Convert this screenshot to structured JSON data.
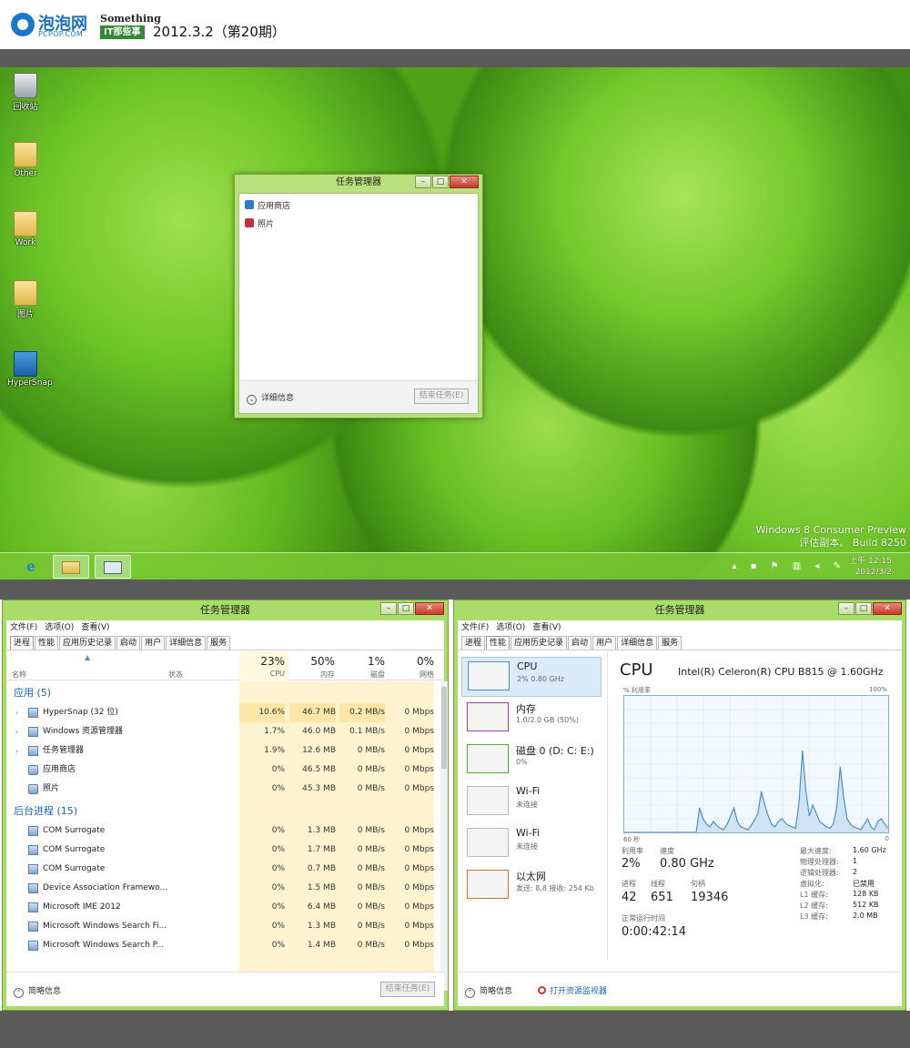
{
  "banner": {
    "logo_cn": "泡泡网",
    "logo_en": "PCPOP.COM",
    "column_en": "Something",
    "column_cn": "IT那些事",
    "issue": "2012.3.2（第20期）"
  },
  "desktop": {
    "icons": [
      {
        "label": "回收站",
        "icon": "recycle-bin-icon"
      },
      {
        "label": "Other",
        "icon": "folder-icon"
      },
      {
        "label": "Work",
        "icon": "folder-icon"
      },
      {
        "label": "图片",
        "icon": "folder-icon"
      },
      {
        "label": "HyperSnap",
        "icon": "hypersnap-icon"
      }
    ],
    "watermark_line1": "Windows 8 Consumer Preview",
    "watermark_line2": "评估副本。 Build 8250",
    "clock_time": "上午 12:15",
    "clock_date": "2012/3/2"
  },
  "small_tm": {
    "title": "任务管理器",
    "items": [
      "应用商店",
      "照片"
    ],
    "details": "详细信息",
    "end_task": "结束任务(E)"
  },
  "menu": [
    "文件(F)",
    "选项(O)",
    "查看(V)"
  ],
  "tabs": [
    "进程",
    "性能",
    "应用历史记录",
    "启动",
    "用户",
    "详细信息",
    "服务"
  ],
  "processes": {
    "title": "任务管理器",
    "col_name": "名称",
    "col_status": "状态",
    "cpu_pct": "23%",
    "cpu_lbl": "CPU",
    "mem_pct": "50%",
    "mem_lbl": "内存",
    "disk_pct": "1%",
    "disk_lbl": "磁盘",
    "net_pct": "0%",
    "net_lbl": "网络",
    "group_apps": "应用 (5)",
    "group_bg": "后台进程 (15)",
    "apps": [
      {
        "name": "HyperSnap (32 位)",
        "cpu": "10.6%",
        "mem": "46.7 MB",
        "disk": "0.2 MB/s",
        "net": "0 Mbps",
        "expand": "›"
      },
      {
        "name": "Windows 资源管理器",
        "cpu": "1.7%",
        "mem": "46.0 MB",
        "disk": "0.1 MB/s",
        "net": "0 Mbps",
        "expand": "›"
      },
      {
        "name": "任务管理器",
        "cpu": "1.9%",
        "mem": "12.6 MB",
        "disk": "0 MB/s",
        "net": "0 Mbps",
        "expand": "›"
      },
      {
        "name": "应用商店",
        "cpu": "0%",
        "mem": "46.5 MB",
        "disk": "0 MB/s",
        "net": "0 Mbps",
        "expand": ""
      },
      {
        "name": "照片",
        "cpu": "0%",
        "mem": "45.3 MB",
        "disk": "0 MB/s",
        "net": "0 Mbps",
        "expand": ""
      }
    ],
    "background": [
      {
        "name": "COM Surrogate",
        "cpu": "0%",
        "mem": "1.3 MB",
        "disk": "0 MB/s",
        "net": "0 Mbps"
      },
      {
        "name": "COM Surrogate",
        "cpu": "0%",
        "mem": "1.7 MB",
        "disk": "0 MB/s",
        "net": "0 Mbps"
      },
      {
        "name": "COM Surrogate",
        "cpu": "0%",
        "mem": "0.7 MB",
        "disk": "0 MB/s",
        "net": "0 Mbps"
      },
      {
        "name": "Device Association Framewo...",
        "cpu": "0%",
        "mem": "1.5 MB",
        "disk": "0 MB/s",
        "net": "0 Mbps"
      },
      {
        "name": "Microsoft IME 2012",
        "cpu": "0%",
        "mem": "6.4 MB",
        "disk": "0 MB/s",
        "net": "0 Mbps"
      },
      {
        "name": "Microsoft Windows Search Fi...",
        "cpu": "0%",
        "mem": "1.3 MB",
        "disk": "0 MB/s",
        "net": "0 Mbps"
      },
      {
        "name": "Microsoft Windows Search P...",
        "cpu": "0%",
        "mem": "1.4 MB",
        "disk": "0 MB/s",
        "net": "0 Mbps"
      }
    ],
    "brief": "简略信息",
    "end_task": "结束任务(E)"
  },
  "performance": {
    "title": "任务管理器",
    "side": [
      {
        "title": "CPU",
        "sub": "2% 0.80 GHz",
        "color": "#4a90c8"
      },
      {
        "title": "内存",
        "sub": "1.0/2.0 GB (50%)",
        "color": "#9b3fb5"
      },
      {
        "title": "磁盘 0 (D: C: E:)",
        "sub": "0%",
        "color": "#4caf2f"
      },
      {
        "title": "Wi-Fi",
        "sub": "未连接",
        "color": "#bbbbbb"
      },
      {
        "title": "Wi-Fi",
        "sub": "未连接",
        "color": "#bbbbbb"
      },
      {
        "title": "以太网",
        "sub": "发送: 8.8 接收: 254 Kb",
        "color": "#c8762e"
      }
    ],
    "cpu_title": "CPU",
    "cpu_model": "Intel(R) Celeron(R) CPU B815 @ 1.60GHz",
    "util_label": "% 利用率",
    "pct_max": "100%",
    "graph_left": "60 秒",
    "graph_right": "0",
    "cpu_series": [
      0,
      0,
      0,
      0,
      0,
      0,
      0,
      0,
      0,
      0,
      0,
      0,
      0,
      0,
      0,
      0,
      0,
      0,
      0,
      0,
      0,
      0,
      18,
      10,
      6,
      4,
      8,
      5,
      3,
      2,
      6,
      12,
      18,
      8,
      4,
      3,
      2,
      5,
      9,
      14,
      30,
      20,
      12,
      6,
      4,
      8,
      10,
      7,
      5,
      4,
      3,
      22,
      60,
      30,
      12,
      20,
      14,
      8,
      6,
      4,
      3,
      6,
      18,
      48,
      26,
      10,
      6,
      4,
      3,
      2,
      6,
      10,
      4,
      2,
      8,
      10,
      6,
      3
    ],
    "stats": {
      "util_lbl": "利用率",
      "util_val": "2%",
      "speed_lbl": "速度",
      "speed_val": "0.80 GHz",
      "proc_lbl": "进程",
      "proc_val": "42",
      "thread_lbl": "线程",
      "thread_val": "651",
      "handle_lbl": "句柄",
      "handle_val": "19346",
      "uptime_lbl": "正常运行时间",
      "uptime_val": "0:00:42:14"
    },
    "specs": [
      {
        "k": "最大速度:",
        "v": "1.60 GHz"
      },
      {
        "k": "物理处理器:",
        "v": "1"
      },
      {
        "k": "逻辑处理器:",
        "v": "2"
      },
      {
        "k": "虚拟化:",
        "v": "已禁用"
      },
      {
        "k": "L1 缓存:",
        "v": "128 KB"
      },
      {
        "k": "L2 缓存:",
        "v": "512 KB"
      },
      {
        "k": "L3 缓存:",
        "v": "2.0 MB"
      }
    ],
    "brief": "简略信息",
    "resmon": "打开资源监视器"
  },
  "colors": {
    "window_frame": "#a9dc69",
    "accent_blue": "#1c63b7",
    "heat_yellow": "#fff4cf",
    "graph_line": "#4a90c8"
  }
}
